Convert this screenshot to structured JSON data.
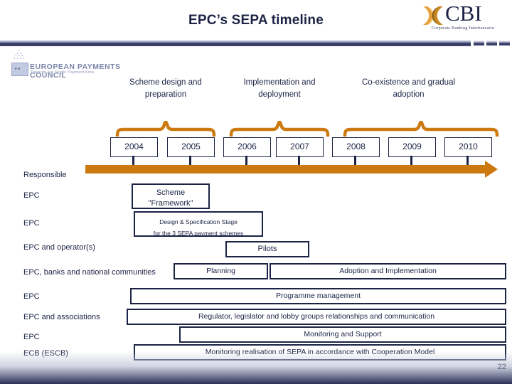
{
  "slide": {
    "title": "EPC’s SEPA timeline",
    "page_number": "22",
    "accent_orange": "#cc7a10",
    "accent_navy": "#1d2345"
  },
  "logos": {
    "cbi": {
      "wordmark": "CBI",
      "tagline": "Corporate Banking Interbancario",
      "mark_icon": "cbi-butterfly-icon"
    },
    "epc": {
      "name": "EUROPEAN PAYMENTS COUNCIL",
      "tagline": "Towards our Single Payment Area",
      "mark_icon": "epc-stars-icon"
    }
  },
  "phases": [
    {
      "label": "Scheme design and preparation",
      "line1": "Scheme design and",
      "line2": "preparation"
    },
    {
      "label": "Implementation and deployment",
      "line1": "Implementation and",
      "line2": "deployment"
    },
    {
      "label": "Co-existence and gradual adoption",
      "line1": "Co-existence and gradual",
      "line2": "adoption"
    }
  ],
  "years": [
    "2004",
    "2005",
    "2006",
    "2007",
    "2008",
    "2009",
    "2010"
  ],
  "responsible": {
    "header": "Responsible",
    "rows": [
      "EPC",
      "EPC",
      "EPC and operator(s)",
      "EPC, banks and national communities",
      "EPC",
      "EPC and associations",
      "EPC",
      "ECB (ESCB)"
    ]
  },
  "activities": [
    {
      "name": "scheme-framework",
      "line1": "Scheme",
      "line2": "\"Framework\""
    },
    {
      "name": "design-specification",
      "line1": "Design & Specification Stage",
      "line2": "for the 3 SEPA payment schemes"
    },
    {
      "name": "pilots",
      "line1": "Pilots",
      "line2": ""
    },
    {
      "name": "planning",
      "line1": "Planning",
      "line2": ""
    },
    {
      "name": "adoption-implementation",
      "line1": "Adoption and Implementation",
      "line2": ""
    },
    {
      "name": "programme-management",
      "line1": "Programme management",
      "line2": ""
    },
    {
      "name": "regulator-relationships",
      "line1": "Regulator, legislator and lobby groups relationships and communication",
      "line2": ""
    },
    {
      "name": "monitoring-support",
      "line1": "Monitoring and Support",
      "line2": ""
    },
    {
      "name": "monitoring-realisation",
      "line1": "Monitoring realisation of SEPA in accordance with Cooperation Model",
      "line2": ""
    }
  ]
}
